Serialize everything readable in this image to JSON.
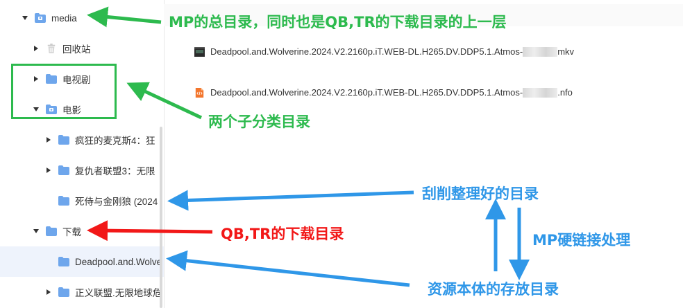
{
  "tree": {
    "items": [
      {
        "label": "media",
        "expanded": true,
        "icon": "media-folder-icon"
      },
      {
        "label": "回收站",
        "expanded": false,
        "icon": "recycle-bin-icon"
      },
      {
        "label": "电视剧",
        "expanded": false,
        "icon": "folder-icon"
      },
      {
        "label": "电影",
        "expanded": true,
        "icon": "media-folder-icon"
      },
      {
        "label": "疯狂的麦克斯4：狂",
        "expanded": false,
        "icon": "folder-icon"
      },
      {
        "label": "复仇者联盟3：无限",
        "expanded": false,
        "icon": "folder-icon"
      },
      {
        "label": "死侍与金刚狼 (2024",
        "expanded": false,
        "icon": "folder-icon"
      },
      {
        "label": "下载",
        "expanded": true,
        "icon": "folder-icon"
      },
      {
        "label": "Deadpool.and.Wolve",
        "expanded": false,
        "icon": "folder-icon",
        "selected": true
      },
      {
        "label": "正义联盟.无限地球危",
        "expanded": false,
        "icon": "folder-icon"
      }
    ]
  },
  "files": [
    {
      "name_prefix": "Deadpool.and.Wolverine.2024.V2.2160p.iT.WEB-DL.H265.DV.DDP5.1.Atmos-",
      "name_suffix": "mkv",
      "icon": "video-file-icon"
    },
    {
      "name_prefix": "Deadpool.and.Wolverine.2024.V2.2160p.iT.WEB-DL.H265.DV.DDP5.1.Atmos-",
      "name_suffix": ".nfo",
      "icon": "nfo-file-icon"
    }
  ],
  "annotations": {
    "media_note": "MP的总目录，同时也是QB,TR的下载目录的上一层",
    "categories_note": "两个子分类目录",
    "organized_note": "刮削整理好的目录",
    "download_note": "QB,TR的下载目录",
    "hardlink_note": "MP硬链接处理",
    "source_note": "资源本体的存放目录"
  },
  "colors": {
    "green": "#2dba4e",
    "red": "#f21818",
    "blue": "#2f97e8",
    "folder": "#6ea6ec",
    "selected_row": "#eef3fc"
  }
}
